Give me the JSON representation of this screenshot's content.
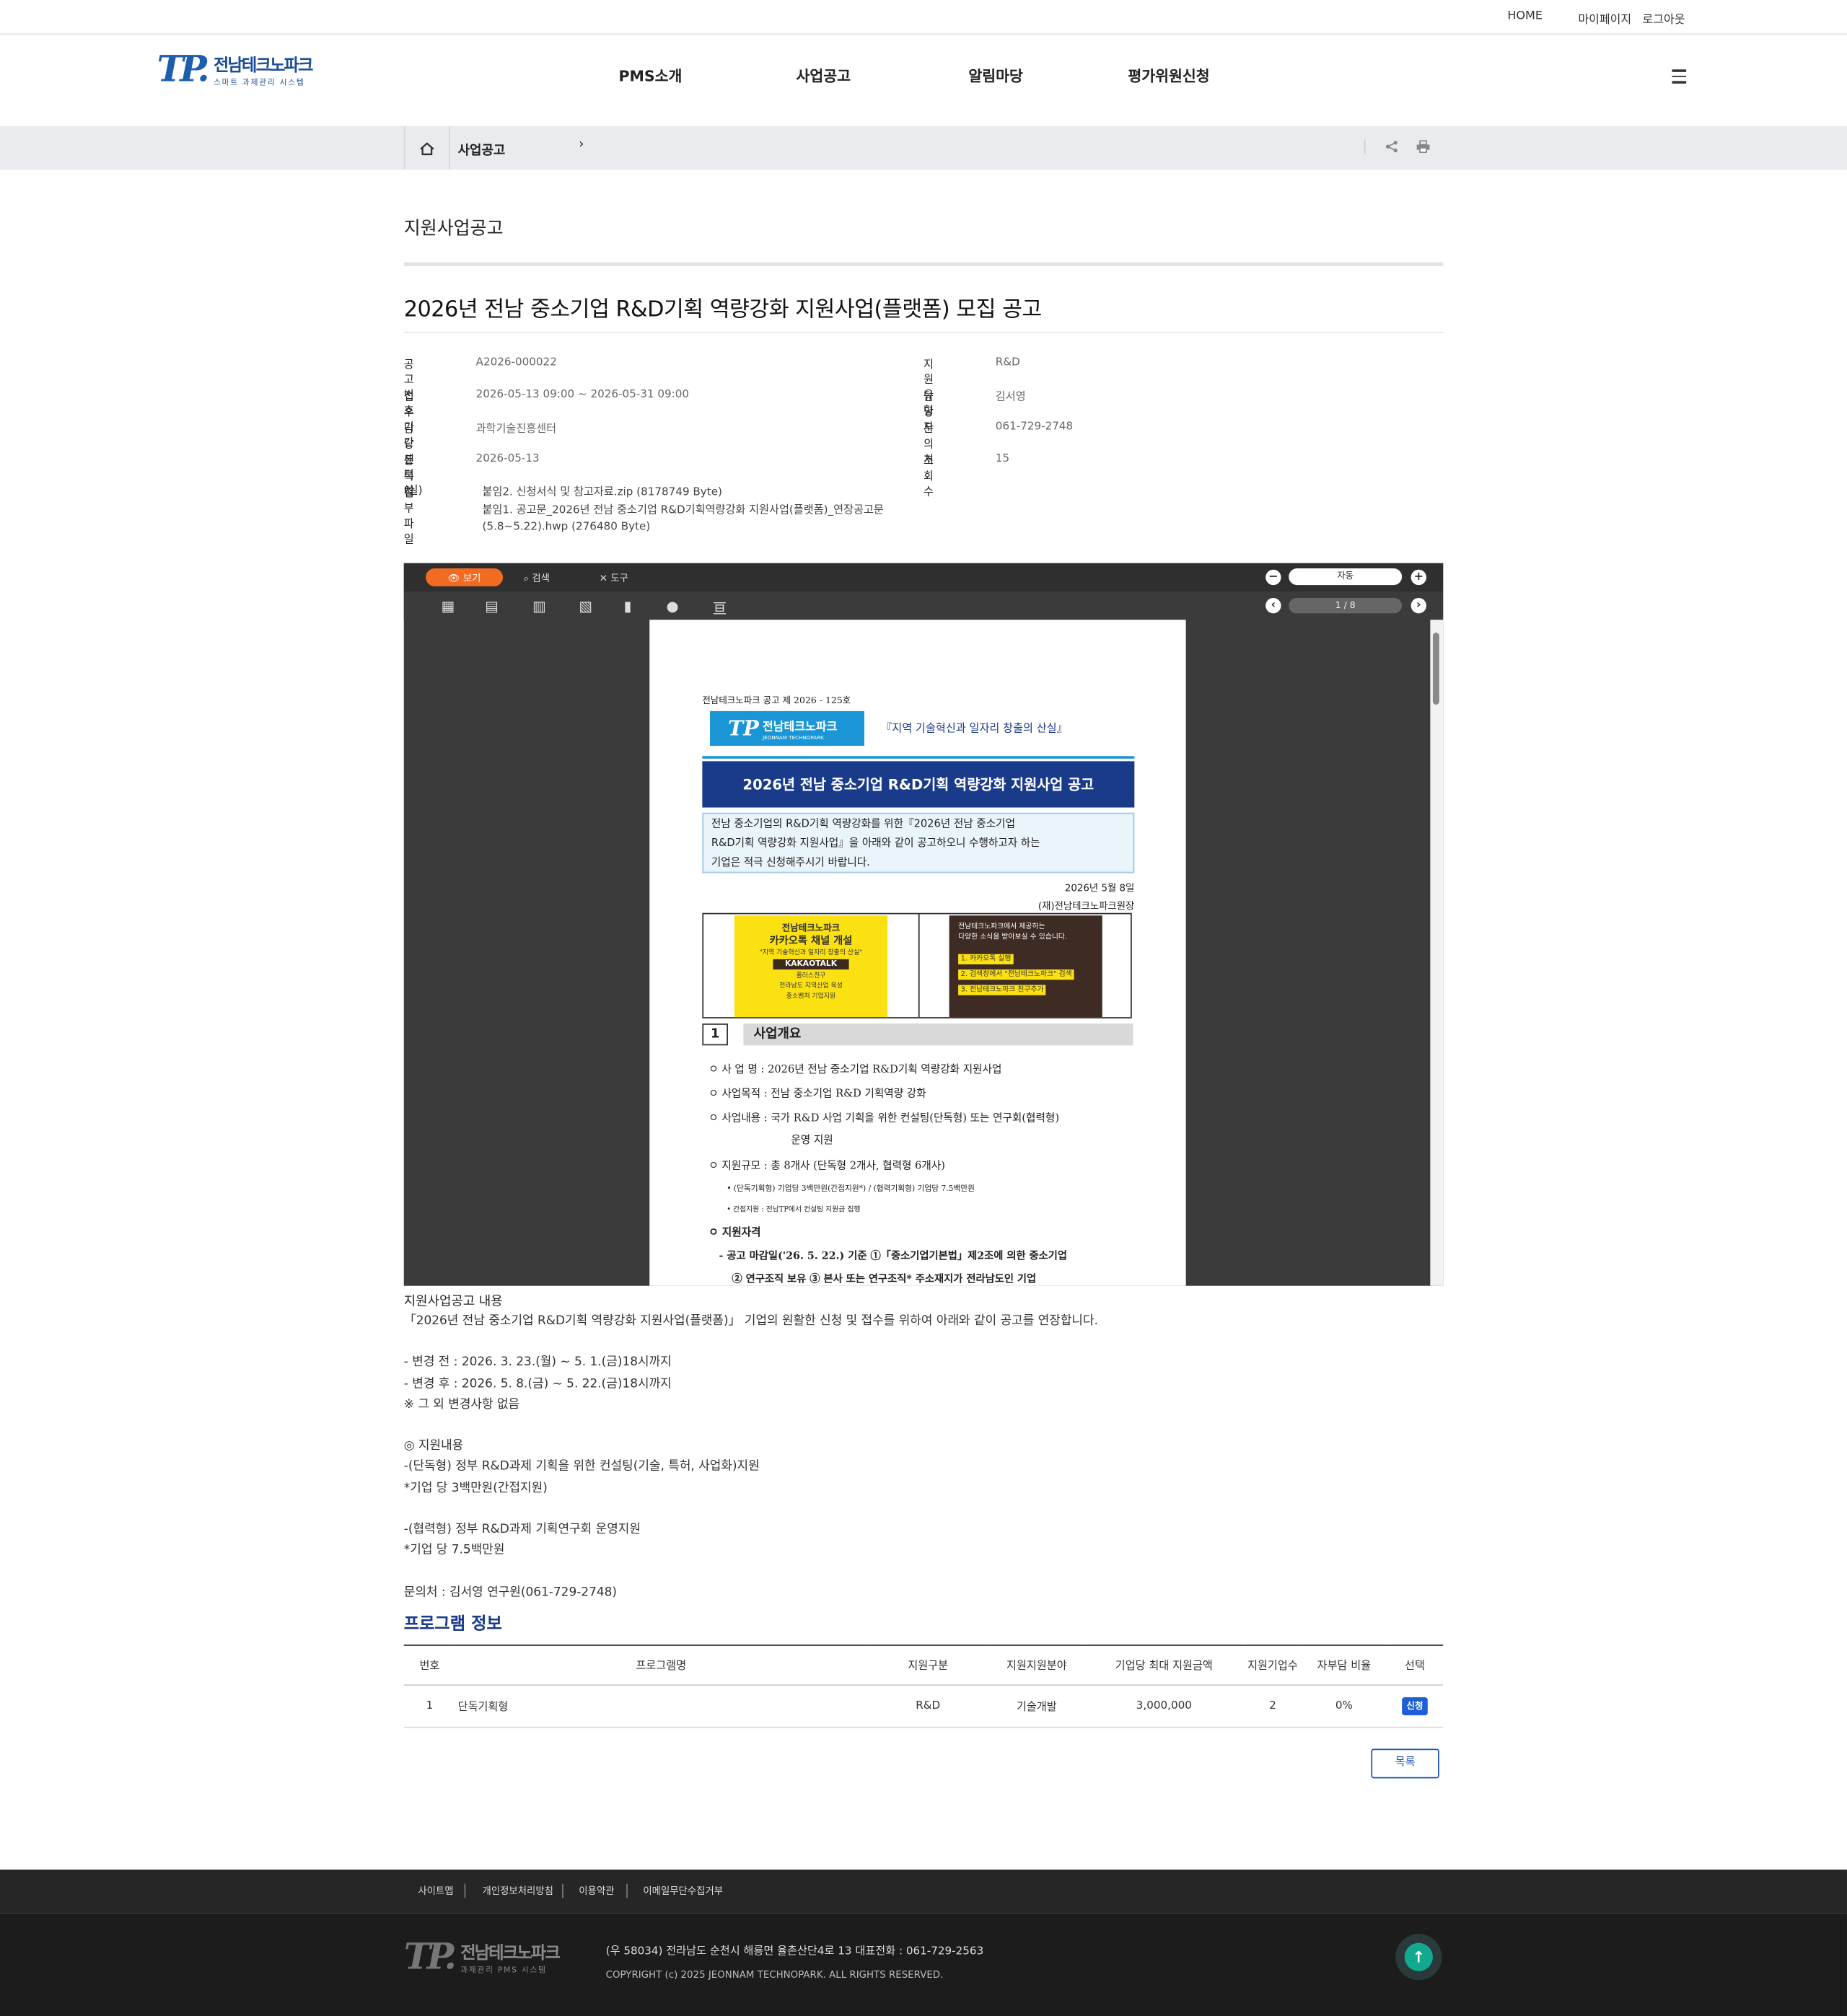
{
  "util": {
    "home": "HOME",
    "mypage": "마이페이지",
    "logout": "로그아웃"
  },
  "logo": {
    "mark_tp": "TP.",
    "name": "전남테크노파크",
    "sub": "스마트 과제관리 시스템"
  },
  "gnb": [
    "PMS소개",
    "사업공고",
    "알림마당",
    "평가위원신청"
  ],
  "breadcrumb": {
    "current": "사업공고",
    "arrow": "›"
  },
  "page_title": "지원사업공고",
  "notice": {
    "title": "2026년 전남 중소기업 R&D기획 역량강화 지원사업(플랫폼) 모집 공고",
    "fields": [
      {
        "k": "공고번호",
        "v": "A2026-000022"
      },
      {
        "k": "지원유형",
        "v": "R&D"
      },
      {
        "k": "접수기간",
        "v": "2026-05-13 09:00 ~ 2026-05-31 09:00"
      },
      {
        "k": "담당자",
        "v": "김서영"
      },
      {
        "k": "담당센터(실)",
        "v": "과학기술진흥센터"
      },
      {
        "k": "문의처",
        "v": "061-729-2748"
      },
      {
        "k": "등록일",
        "v": "2026-05-13"
      },
      {
        "k": "조회수",
        "v": "15"
      }
    ],
    "attach_label": "첨부파일",
    "attachments": [
      "붙임2. 신청서식 및 참고자료.zip (8178749 Byte)",
      "붙임1. 공고문_2026년 전남 중소기업 R&D기획역량강화 지원사업(플랫폼)_연장공고문",
      "(5.8~5.22).hwp (276480 Byte)"
    ]
  },
  "viewer": {
    "view": "보기",
    "search": "검색",
    "tools": "도구",
    "zoom": "자동",
    "page": "1 / 8",
    "doc": {
      "noticeno": "전남테크노파크 공고 제 2026 - 125호",
      "logo_text": "전남테크노파크",
      "logo_sub": "JEONNAM TECHNOPARK",
      "slogan": "『지역 기술혁신과 일자리 창출의 산실』",
      "banner": "2026년 전남 중소기업 R&D기획 역량강화 지원사업 공고",
      "intro": [
        "전남 중소기업의 R&D기획 역량강화를 위한『2026년 전남 중소기업",
        "R&D기획 역량강화 지원사업』을 아래와 같이 공고하오니 수행하고자 하는",
        "기업은 적극 신청해주시기 바랍니다."
      ],
      "date": "2026년   5월   8일",
      "org": "(재)전남테크노파크원장",
      "kakao_left": [
        "전남테크노파크",
        "카카오톡 채널 개설",
        "\"지역 기술혁신과 일자리 창출의 산실\"",
        "KAKAOTALK",
        "플러스친구",
        "전라남도 지역산업 육성",
        "중소벤처 기업지원"
      ],
      "kakao_right": [
        "전남테크노파크에서 제공하는",
        "다양한 소식을 받아보실 수 있습니다.",
        "1. 카카오톡 실행",
        "2. 검색창에서 \"전남테크노파크\" 검색",
        "3. 전남테크노파크 친구추가"
      ],
      "sec_no": "1",
      "sec_title": "사업개요",
      "items": [
        "ㅇ 사 업 명 : 2026년 전남 중소기업 R&D기획 역량강화 지원사업",
        "ㅇ 사업목적 : 전남 중소기업 R&D 기획역량 강화",
        "ㅇ 사업내용 : 국가 R&D 사업 기획을 위한 컨설팅(단독형) 또는 연구회(협력형)",
        "운영 지원",
        "ㅇ 지원규모 : 총 8개사 (단독형 2개사, 협력형 6개사)",
        "• (단독기획형) 기업당 3백만원(간접지원*) / (협력기획형) 기업당 7.5백만원",
        "• 간접지원 : 전남TP에서 컨설팅 지원금 집행",
        "ㅇ 지원자격",
        "- 공고 마감일('26. 5. 22.) 기준 ①「중소기업기본법」제2조에 의한 중소기업",
        "② 연구조직 보유 ③ 본사 또는 연구조직* 주소재지가 전라남도인 기업"
      ]
    }
  },
  "content": {
    "heading": "지원사업공고 내용",
    "body": "「2026년 전남 중소기업 R&D기획 역량강화 지원사업(플랫폼)」 기업의 원활한 신청 및 접수를 위하여 아래와 같이 공고를 연장합니다.\n\n- 변경 전 : 2026. 3. 23.(월) ~ 5. 1.(금)18시까지\n- 변경 후 : 2026. 5. 8.(금) ~ 5. 22.(금)18시까지\n※ 그 외 변경사항 없음\n\n◎ 지원내용\n-(단독형) 정부 R&D과제 기획을 위한 컨설팅(기술, 특허, 사업화)지원\n*기업 당 3백만원(간접지원)\n\n-(협력형) 정부 R&D과제 기획연구회 운영지원\n*기업 당 7.5백만원\n\n문의처 : 김서영 연구원(061-729-2748)"
  },
  "program": {
    "title": "프로그램 정보",
    "headers": [
      "번호",
      "프로그램명",
      "지원구분",
      "지원지원분야",
      "기업당 최대 지원금액",
      "지원기업수",
      "자부담 비율",
      "선택"
    ],
    "rows": [
      {
        "no": "1",
        "name": "단독기획형",
        "type": "R&D",
        "field": "기술개발",
        "amount": "3,000,000",
        "count": "2",
        "ratio": "0%",
        "select": "신청"
      }
    ]
  },
  "list_button": "목록",
  "footer": {
    "links": [
      "사이트맵",
      "개인정보처리방침",
      "이용약관",
      "이메일무단수집거부"
    ],
    "logo_name": "전남테크노파크",
    "logo_sub": "과제관리 PMS 시스템",
    "address": "(우 58034) 전라남도 순천시 해룡면 율촌산단4로 13    대표전화 : 061-729-2563",
    "copyright": "COPYRIGHT (c) 2025 JEONNAM TECHNOPARK. ALL RIGHTS RESERVED."
  },
  "colors": {
    "accent": "#1d5fae",
    "orange": "#f26b22",
    "apply": "#1c5fd6",
    "top_button": "#13a98f"
  }
}
